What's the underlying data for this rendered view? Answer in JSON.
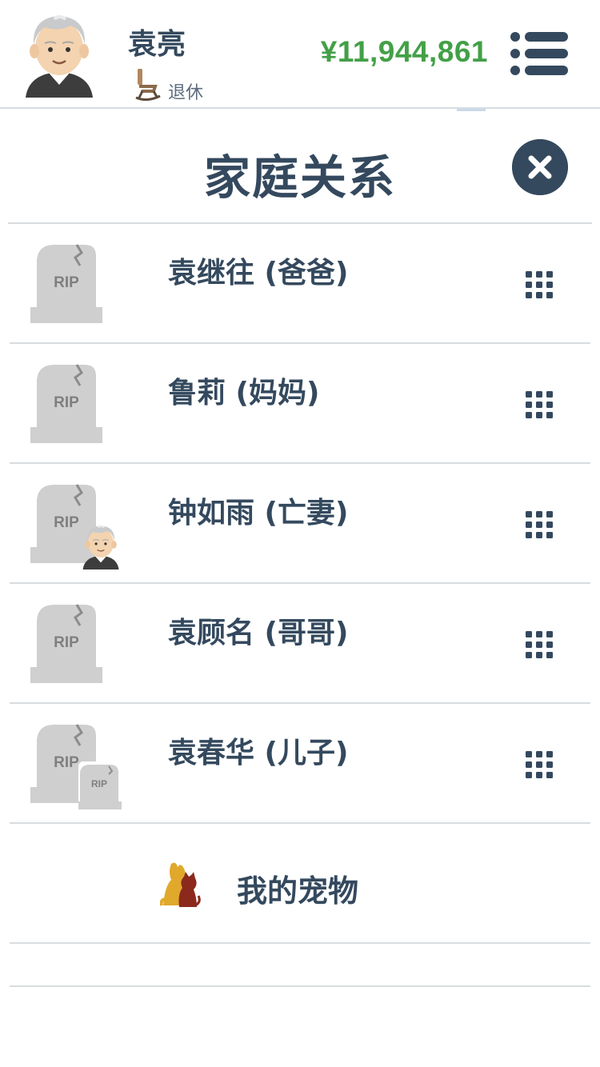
{
  "header": {
    "user_name": "袁亮",
    "status": "退休",
    "status_icon": "rocking-chair-icon",
    "money": "¥11,944,861",
    "money_color": "#43a047",
    "menu_icon": "menu-icon"
  },
  "modal": {
    "title": "家庭关系",
    "close_icon": "close-icon"
  },
  "family": [
    {
      "label": "袁继往 (爸爸)",
      "icon": "rip-tombstone-icon",
      "action_icon": "grid-dots-icon"
    },
    {
      "label": "鲁莉 (妈妈)",
      "icon": "rip-tombstone-icon",
      "action_icon": "grid-dots-icon"
    },
    {
      "label": "钟如雨 (亡妻)",
      "icon": "rip-tombstone-with-elder-icon",
      "action_icon": "grid-dots-icon"
    },
    {
      "label": "袁顾名 (哥哥)",
      "icon": "rip-tombstone-icon",
      "action_icon": "grid-dots-icon"
    },
    {
      "label": "袁春华 (儿子)",
      "icon": "rip-tombstone-double-icon",
      "action_icon": "grid-dots-icon"
    }
  ],
  "pets": {
    "label": "我的宠物",
    "icon": "dog-cat-icon"
  },
  "tombstone_text": "RIP",
  "colors": {
    "text": "#34495e",
    "divider": "#d9dde0",
    "tombstone": "#cfcfcf",
    "tombstone_text": "#7f7f7f"
  }
}
